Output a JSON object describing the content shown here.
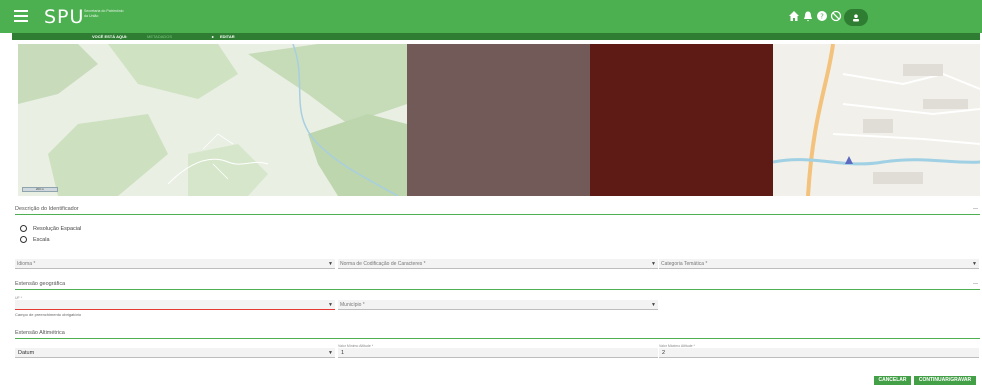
{
  "header": {
    "brand": "SPU",
    "brand_sub": "Secretaria do Patrimônio da União",
    "icons": [
      "home-icon",
      "bell-icon",
      "help-icon",
      "block-icon",
      "user-icon"
    ]
  },
  "breadcrumb": {
    "here_label": "VOCÊ ESTÁ AQUI:",
    "parent_link": "METADADOS",
    "separator": "▸",
    "current": "EDITAR"
  },
  "map": {
    "scale_label": "200 m"
  },
  "identificador": {
    "title": "Descrição do Identificador",
    "collapse": "—",
    "radio_options": [
      "Resolução Espacial",
      "Escala"
    ]
  },
  "row1": {
    "idioma": "Idioma *",
    "norma": "Norma de Codificação de Caracteres *",
    "categoria": "Categoria Temática *"
  },
  "extensao_geografica": {
    "title": "Extensão geográfica",
    "collapse": "—",
    "uf_label": "UF *",
    "municipio_label": "Município *",
    "required_hint": "Campo de preenchimento obrigatório"
  },
  "extensao_altimetrica": {
    "title": "Extensão Altimétrica",
    "datum_label": "Datum",
    "min_label": "Valor Mínimo Altitude *",
    "min_value": "1",
    "max_label": "Valor Máximo Altitude *",
    "max_value": "2"
  },
  "buttons": {
    "cancel": "CANCELAR",
    "save": "CONTINUAR/GRAVAR"
  },
  "colors": {
    "header_green": "#4caf50",
    "dark_green": "#2e7d32",
    "error_red": "#e53935"
  }
}
